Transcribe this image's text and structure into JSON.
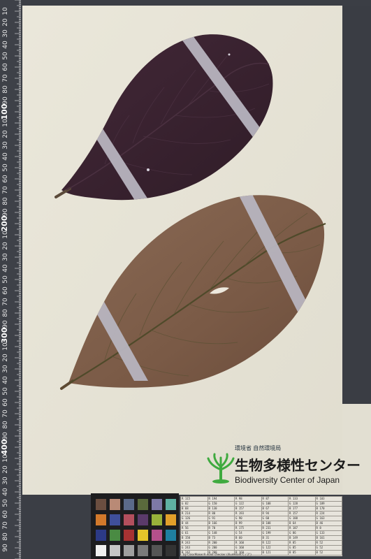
{
  "label": {
    "ministry": "環境省 自然環境局",
    "center_jp": "生物多様性センター",
    "center_en": "Biodiversity Center of Japan"
  },
  "ruler": {
    "unit": "mm",
    "major_labels": [
      "100",
      "200",
      "300",
      "400",
      "500"
    ],
    "minor_labels": [
      "10",
      "20",
      "30",
      "40",
      "50",
      "60",
      "70",
      "80",
      "90"
    ]
  },
  "color_table": {
    "rows": [
      [
        "R 115",
        "R 194",
        "R 98",
        "R 87",
        "R 133",
        "R 103"
      ],
      [
        "G 82",
        "G 150",
        "G 122",
        "G 108",
        "G 128",
        "G 189"
      ],
      [
        "B 68",
        "B 130",
        "B 157",
        "B 67",
        "B 177",
        "B 170"
      ],
      [
        "R 214",
        "R 80",
        "R 193",
        "R 94",
        "R 157",
        "R 224"
      ],
      [
        "G 126",
        "G 91",
        "G 90",
        "G 60",
        "G 188",
        "G 163"
      ],
      [
        "B 44",
        "B 166",
        "B 99",
        "B 108",
        "B 64",
        "B 46"
      ],
      [
        "R 56",
        "R 70",
        "R 175",
        "R 231",
        "R 187",
        "R 8"
      ],
      [
        "G 61",
        "G 148",
        "G 54",
        "G 199",
        "G 86",
        "G 133"
      ],
      [
        "B 150",
        "B 73",
        "B 60",
        "B 31",
        "B 149",
        "B 161"
      ],
      [
        "R 243",
        "R 200",
        "R 160",
        "R 122",
        "R 85",
        "R 52"
      ],
      [
        "G 243",
        "G 200",
        "G 160",
        "G 122",
        "G 85",
        "G 52"
      ],
      [
        "B 242",
        "B 200",
        "B 160",
        "B 121",
        "B 85",
        "B 52"
      ]
    ],
    "caption": "by ColorMaker® color checker (Illuminant C / 2°)"
  },
  "colors": {
    "mount_paper": "#e6e3d6",
    "ruler_bg": "#3e4148",
    "upper_leaf": "#3b2330",
    "lower_leaf": "#7a5a46",
    "tape": "#b7b4bf",
    "logo_green": "#3faa3f"
  },
  "patches": [
    "#6b4e40",
    "#b98a76",
    "#5b6a8a",
    "#5a6a3c",
    "#7d79a6",
    "#5fb1a2",
    "#d2792b",
    "#3f4f9b",
    "#b34f5d",
    "#5a3a6a",
    "#98b23a",
    "#e2a02a",
    "#2c3a86",
    "#4a8b43",
    "#a63232",
    "#e4c52a",
    "#b4508b",
    "#1f7fa0",
    "#f1f1f0",
    "#c6c6c6",
    "#9f9f9f",
    "#7a7a7a",
    "#555555",
    "#333333"
  ]
}
